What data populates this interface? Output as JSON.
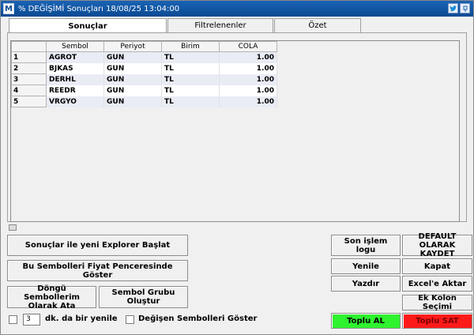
{
  "window": {
    "app_icon_letter": "M",
    "title": "% DEĞİŞİMİ Sonuçları  18/08/25 13:04:00"
  },
  "tabs": [
    {
      "label": "Sonuçlar",
      "active": true
    },
    {
      "label": "Filtrelenenler",
      "active": false
    },
    {
      "label": "Özet",
      "active": false
    }
  ],
  "table": {
    "columns": [
      "Sembol",
      "Periyot",
      "Birim",
      "COLA"
    ],
    "rows": [
      {
        "n": "1",
        "sembol": "AGROT",
        "periyot": "GUN",
        "birim": "TL",
        "cola": "1.00"
      },
      {
        "n": "2",
        "sembol": "BJKAS",
        "periyot": "GUN",
        "birim": "TL",
        "cola": "1.00"
      },
      {
        "n": "3",
        "sembol": "DERHL",
        "periyot": "GUN",
        "birim": "TL",
        "cola": "1.00"
      },
      {
        "n": "4",
        "sembol": "REEDR",
        "periyot": "GUN",
        "birim": "TL",
        "cola": "1.00"
      },
      {
        "n": "5",
        "sembol": "VRGYO",
        "periyot": "GUN",
        "birim": "TL",
        "cola": "1.00"
      }
    ]
  },
  "left_buttons": {
    "explorer": "Sonuçlar ile yeni Explorer Başlat",
    "fiyat": "Bu Sembolleri Fiyat Penceresinde Göster",
    "dongu": "Döngü Sembollerim Olarak Ata",
    "grup": "Sembol Grubu Oluştur"
  },
  "refresh": {
    "value": "3",
    "label": "dk. da bir yenile",
    "changed_label": "Değişen Sembolleri Göster"
  },
  "right_buttons": {
    "log": "Son işlem logu",
    "default": "DEFAULT OLARAK KAYDET",
    "yenile": "Yenile",
    "kapat": "Kapat",
    "yazdir": "Yazdır",
    "excel": "Excel'e Aktar",
    "ek_kolon": "Ek Kolon Seçimi",
    "toplu_al": "Toplu AL",
    "toplu_sat": "Toplu SAT"
  },
  "colors": {
    "buy": "#2ff22f",
    "sell": "#ff1a1a",
    "titlebar": "#1a63b5"
  }
}
